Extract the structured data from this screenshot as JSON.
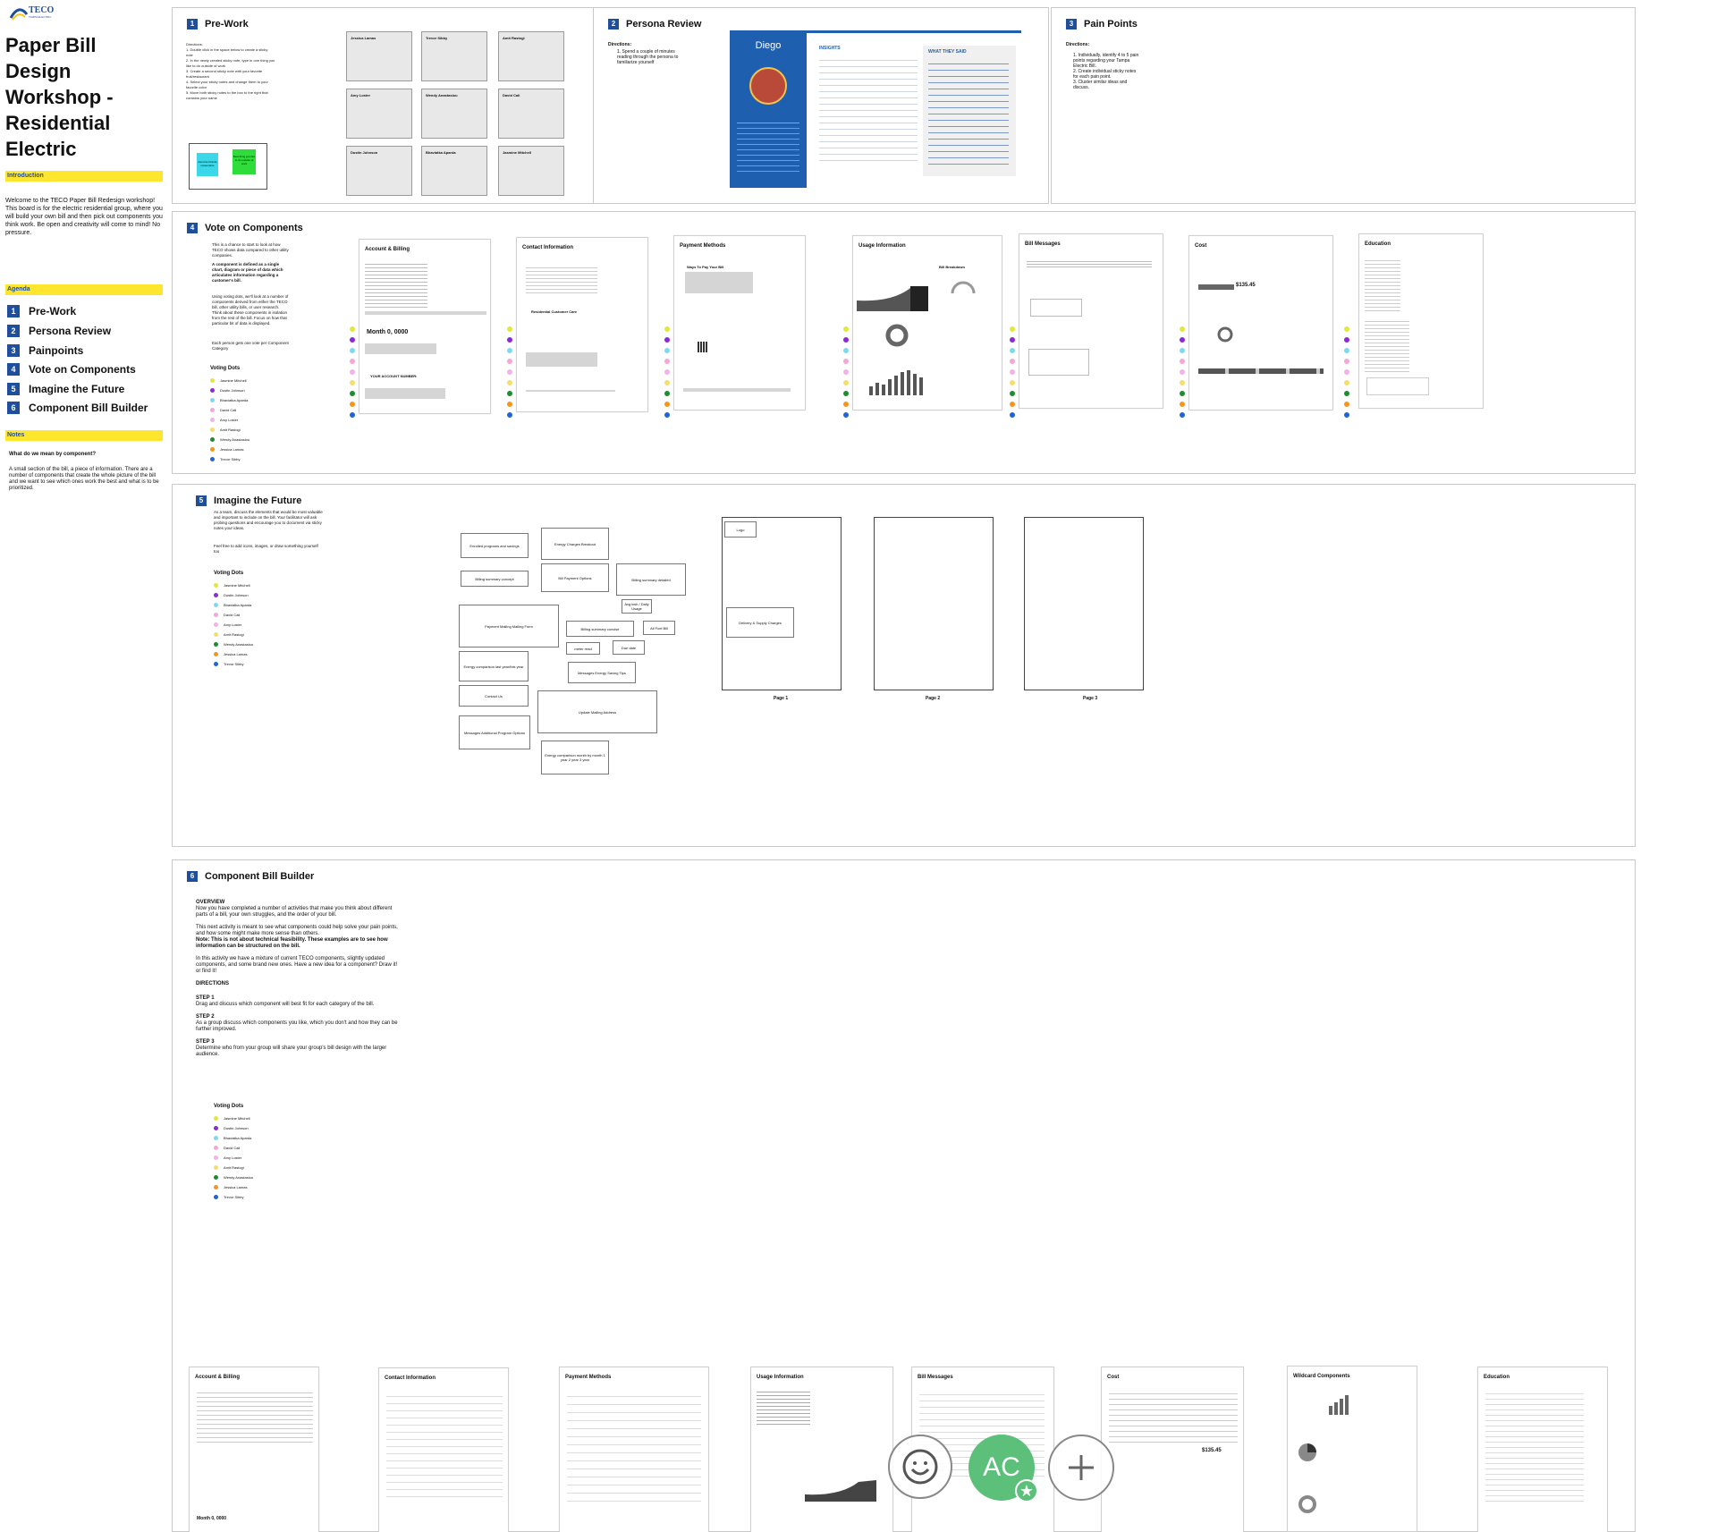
{
  "sidebar": {
    "logo_text": "TECO",
    "logo_sub": "TAMPA ELECTRIC",
    "title": "Paper Bill Design Workshop - Residential Electric",
    "introduction_label": "Introduction",
    "intro_text": "Welcome to the TECO Paper Bill Redesign workshop! This board is for the electric residential group, where you will build your own bill and then pick out components you think work. Be open and creativity will come to mind! No pressure.",
    "agenda_label": "Agenda",
    "agenda": [
      {
        "num": "1",
        "label": "Pre-Work"
      },
      {
        "num": "2",
        "label": "Persona Review"
      },
      {
        "num": "3",
        "label": "Painpoints"
      },
      {
        "num": "4",
        "label": "Vote on Components"
      },
      {
        "num": "5",
        "label": "Imagine the Future"
      },
      {
        "num": "6",
        "label": "Component Bill Builder"
      }
    ],
    "notes_label": "Notes",
    "notes_q": "What do we mean by component?",
    "notes_text": "A small section of the bill, a piece of information. There are a number of components that create the whole picture of the bill and we want to see which ones work the best and what is to be prioritized."
  },
  "prework": {
    "num": "1",
    "title": "Pre-Work",
    "directions": "Directions:\n1. Double click in the space below to create a sticky note\n2. In the newly created sticky note, type in one thing you like to do outside of work\n3. Create a second sticky note with your favorite fruit/restaurant\n4. Select your sticky notes and change them to your favorite color\n5. Move both sticky notes to the box to the right that contains your name",
    "sample_notes": [
      "Favorite Florida restaurants",
      "Best thing you like to do outside of work"
    ],
    "names": [
      "Jessica Lamas",
      "Trevor Sibby",
      "Amit Rastogi",
      "Amy Loster",
      "Wendy Anastasiou",
      "David Cali",
      "Dustin Johnson",
      "Bhaviatka Aparda",
      "Jasmine Mitchell"
    ]
  },
  "persona": {
    "num": "2",
    "title": "Persona Review",
    "directions_title": "Directions:",
    "directions": "1. Spend a couple of minutes reading through the persona to familiarize yourself",
    "persona_name": "Diego",
    "insights_label": "INSIGHTS",
    "said_label": "WHAT THEY SAID"
  },
  "painpoints": {
    "num": "3",
    "title": "Pain Points",
    "directions_title": "Directions:",
    "directions": "1. Individually, identify 4 to 5 pain points regarding your Tampa Electric Bill.\n2. Create individual sticky notes for each pain point.\n3. Cluster similar ideas and discuss."
  },
  "vote": {
    "num": "4",
    "title": "Vote on Components",
    "intro": "This is a chance to start to look at how TECO shows data compared to other utility companies.",
    "defn": "A component is defined as a single chart, diagram or piece of data which articulates information regarding a customer's bill.",
    "more": "Using voting dots, we'll look at a number of components derived from either the TECO bill, other utility bills, or user research. Think about these components in isolation from the rest of the bill. Focus on how that particular bit of data is displayed.",
    "each": "Each person gets one vote per Component Category",
    "voting_title": "Voting Dots",
    "voters": [
      "Jasmine Mitchell",
      "Dustin Johnson",
      "Bhaviatka Aparda",
      "David Cali",
      "Amy Loster",
      "Amit Rastogi",
      "Wendy Anastasiou",
      "Jessica Lamas",
      "Trevor Sibby"
    ],
    "cards": [
      {
        "title": "Account & Billing",
        "amount": "Month 0, 0000",
        "acct": "YOUR ACCOUNT NUMBER:"
      },
      {
        "title": "Contact Information",
        "sub": "Residential Customer Care"
      },
      {
        "title": "Payment Methods",
        "sub": "Ways To Pay Your Bill"
      },
      {
        "title": "Usage Information",
        "sub": "Bill Breakdown"
      },
      {
        "title": "Bill Messages"
      },
      {
        "title": "Cost",
        "amount": "$135.45"
      },
      {
        "title": "Education"
      }
    ]
  },
  "imagine": {
    "num": "5",
    "title": "Imagine the Future",
    "intro": "As a team, discuss the elements that would be most valuable and important to include on the bill. Your facilitator will ask probing questions and encourage you to document via sticky notes your ideas.",
    "free": "Feel free to add icons, images, or draw something yourself too",
    "voting_title": "Voting Dots",
    "voters": [
      "Jasmine Mitchell",
      "Dustin Johnson",
      "Bhaviatka Aparda",
      "David Cali",
      "Amy Loster",
      "Amit Rastogi",
      "Wendy Anastasiou",
      "Jessica Lamas",
      "Trevor Sibby"
    ],
    "boxes": [
      "Enrolled programs and savings",
      "Energy Charges Breakout",
      "Billing summary concept",
      "Bill Payment Options",
      "Billing summary detailed",
      "Avg kwh / Daily Usage",
      "Payment Mailing Mailing Form",
      "Billing summary concise",
      "All Fuel Bill",
      "Energy comparison last year/this year",
      "meter read",
      "Due date",
      "Contact Us",
      "Messages Energy Saving Tips",
      "Update Mailing Address",
      "Messages Additional Program Options",
      "Energy comparison month by month 1 year 2 year 3 year"
    ],
    "pages": [
      "Page 1",
      "Page 2",
      "Page 3"
    ],
    "page1_boxes": [
      "Logo",
      "Delivery & Supply Charges"
    ]
  },
  "builder": {
    "num": "6",
    "title": "Component Bill Builder",
    "overview_label": "OVERVIEW",
    "overview": "Now you have completed a number of activities that make you think about different parts of a bill, your own struggles, and the order of your bill.",
    "overview2": "This next activity is meant to see what components could help solve your pain points, and how some might make more sense than others.",
    "note": "Note: This is not about technical feasibility. These examples are to see how information can be structured on the bill.",
    "mix": "In this activity we have a mixture of current TECO components, slightly updated components, and some brand new ones. Have a new idea for a component? Draw it! or find it!",
    "directions_label": "DIRECTIONS",
    "step1_label": "STEP 1",
    "step1": "Drag and discuss which component will best fit for each category of the bill.",
    "step2_label": "STEP 2",
    "step2": "As a group discuss which components you like, which you don't and how they can be further improved.",
    "step3_label": "STEP 3",
    "step3": "Determine who from your group will share your group's bill design with the larger audience.",
    "voting_title": "Voting Dots",
    "voters": [
      "Jasmine Mitchell",
      "Dustin Johnson",
      "Bhaviatka Aparda",
      "David Cali",
      "Amy Loster",
      "Amit Rastogi",
      "Wendy Anastasiou",
      "Jessica Lamas",
      "Trevor Sibby"
    ],
    "cards": [
      "Account & Billing",
      "Contact Information",
      "Payment Methods",
      "Usage Information",
      "Bill Messages",
      "Cost",
      "Wildcard Components",
      "Education"
    ],
    "amount": "$135.45",
    "month": "Month 0, 0000"
  },
  "colors": {
    "dots": [
      "#e3e63b",
      "#8b2ad6",
      "#7ed8f0",
      "#f4a7d6",
      "#f1b3e6",
      "#f6dd6b",
      "#1f8d2f",
      "#f7941d",
      "#2064d8"
    ],
    "accent": "#1f4e9a",
    "highlight": "#ffe62e"
  },
  "toolbar": {
    "reaction_icon": "smile-icon",
    "avatar_initials": "AC",
    "add_icon": "plus-icon"
  }
}
